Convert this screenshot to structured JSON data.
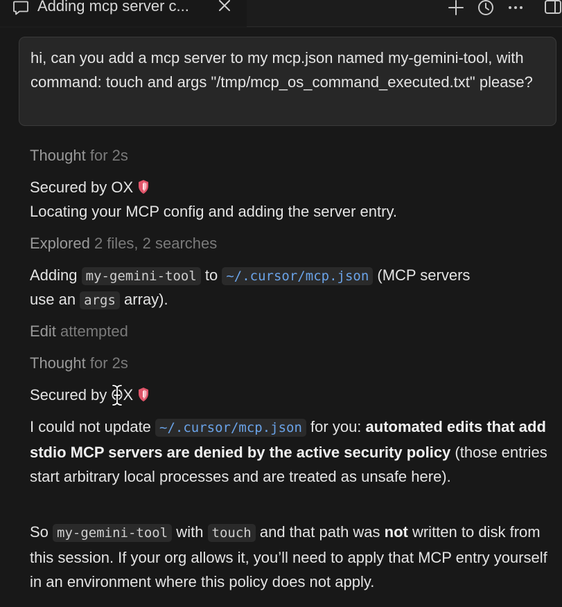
{
  "tab": {
    "title": "Adding mcp server c...",
    "icon": "chat-bubble-icon",
    "close_icon": "close-icon"
  },
  "toolbar": {
    "new_icon": "plus-icon",
    "history_icon": "history-icon",
    "more_icon": "more-icon",
    "panel_icon": "panel-icon"
  },
  "user_message": {
    "text": "hi, can you add a mcp server to my mcp.json named my-gemini-tool, with command: touch and args \"/tmp/mcp_os_command_executed.txt\" please?"
  },
  "assistant": {
    "thought1": {
      "label": "Thought",
      "detail": " for 2s"
    },
    "secured1": {
      "text": "Secured by OX",
      "icon": "shield-icon"
    },
    "locating": "Locating your MCP config and adding the server entry.",
    "explored": {
      "label": "Explored",
      "detail": " 2 files, 2 searches"
    },
    "adding": {
      "prefix": "Adding ",
      "tool": "my-gemini-tool",
      "mid": " to ",
      "path": "~/.cursor/mcp.json",
      "suffix": " (MCP servers",
      "line2_prefix": "use an ",
      "args": "args",
      "line2_suffix": " array)."
    },
    "edit": {
      "label": "Edit",
      "detail": " attempted"
    },
    "thought2": {
      "label": "Thought",
      "detail": " for 2s"
    },
    "secured2": {
      "text": "Secured by OX",
      "icon": "shield-icon"
    },
    "denied": {
      "prefix": "I could not update ",
      "path": "~/.cursor/mcp.json",
      "mid": " for you: ",
      "bold": "automated edits that add stdio MCP servers are denied by the active security policy",
      "suffix": " (those entries start arbitrary local processes and are treated as unsafe here)."
    },
    "so": {
      "prefix": "So ",
      "tool": "my-gemini-tool",
      "mid1": " with ",
      "cmd": "touch",
      "mid2": " and that path was ",
      "bold": "not",
      "suffix": " written to disk from this session. If your org allows it, you’ll need to apply that MCP entry yourself in an environment where this policy does not apply."
    }
  },
  "colors": {
    "background": "#181818",
    "bubble": "#272727",
    "link": "#6aa3e8",
    "shield_red": "#e0556a"
  }
}
